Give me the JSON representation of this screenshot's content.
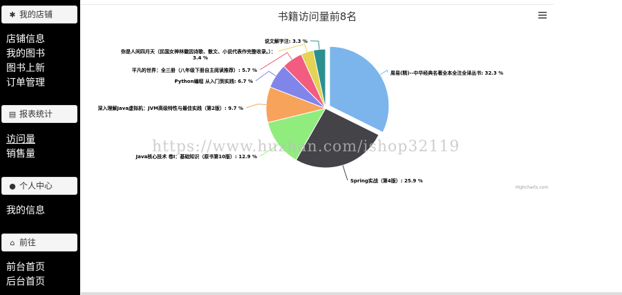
{
  "sidebar": {
    "sections": [
      {
        "title": "我的店铺",
        "icon": "asterisk-icon",
        "items": [
          "店铺信息",
          "我的图书",
          "图书上新",
          "订单管理"
        ]
      },
      {
        "title": "报表统计",
        "icon": "table-icon",
        "items": [
          "访问量",
          "销售量"
        ]
      },
      {
        "title": "个人中心",
        "icon": "user-icon",
        "items": [
          "我的信息"
        ]
      },
      {
        "title": "前往",
        "icon": "home-icon",
        "items": [
          "前台首页",
          "后台首页"
        ]
      }
    ],
    "active_item": "访问量"
  },
  "chart": {
    "menu_icon": "hamburger-icon",
    "credits": "Highcharts.com"
  },
  "watermark": "https://www.huzhan.com/ishop32119",
  "chart_data": {
    "type": "pie",
    "title": "书籍访问量前8名",
    "slices": [
      {
        "label": "周易(精)--中华经典名著全本全注全译丛书",
        "value": 32.3,
        "color": "#7cb5ec"
      },
      {
        "label": "Spring实战（第4版）",
        "value": 25.9,
        "color": "#434348"
      },
      {
        "label": "Java核心技术 卷I：基础知识（原书第10版）",
        "value": 12.9,
        "color": "#90ed7d"
      },
      {
        "label": "深入理解Java虚拟机：JVM高级特性与最佳实践（第2版）",
        "value": 9.7,
        "color": "#f7a35c"
      },
      {
        "label": "Python编程 从入门到实践",
        "value": 6.7,
        "color": "#8085e9"
      },
      {
        "label": "平凡的世界：全三册（八年级下册自主阅读推荐）",
        "value": 5.7,
        "color": "#f15c80"
      },
      {
        "label": "你是人间四月天（民国女神林徽因诗歌、散文、小说代表作完整收录。）",
        "value": 3.4,
        "color": "#e4d354"
      },
      {
        "label": "说文解字注",
        "value": 3.3,
        "color": "#2b908f"
      }
    ],
    "unit": "%"
  }
}
